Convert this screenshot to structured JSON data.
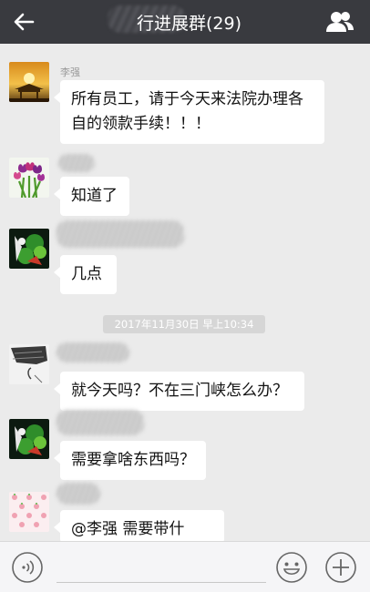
{
  "header": {
    "title": "行进展群(29)",
    "back_icon": "back-arrow-icon",
    "members_icon": "group-members-icon",
    "background": "#393a3f"
  },
  "messages": [
    {
      "sender": "李强",
      "text": "所有员工，请于今天来法院办理各自的领款手续！！！"
    },
    {
      "sender": "",
      "text": "知道了"
    },
    {
      "sender": "",
      "text": "几点"
    },
    {
      "timestamp": "2017年11月30日 早上10:34"
    },
    {
      "sender": "",
      "text": "就今天吗？不在三门峡怎么办？"
    },
    {
      "sender": "",
      "text": "需要拿啥东西吗？"
    },
    {
      "sender": "",
      "text": "@李强 需要带什么？"
    }
  ],
  "toolbar": {
    "voice_icon": "voice-input-icon",
    "emoji_icon": "emoji-icon",
    "plus_icon": "plus-icon"
  },
  "colors": {
    "chat_background": "#ebebeb",
    "bubble": "#ffffff",
    "timestamp_bg": "#d6d6d6"
  }
}
